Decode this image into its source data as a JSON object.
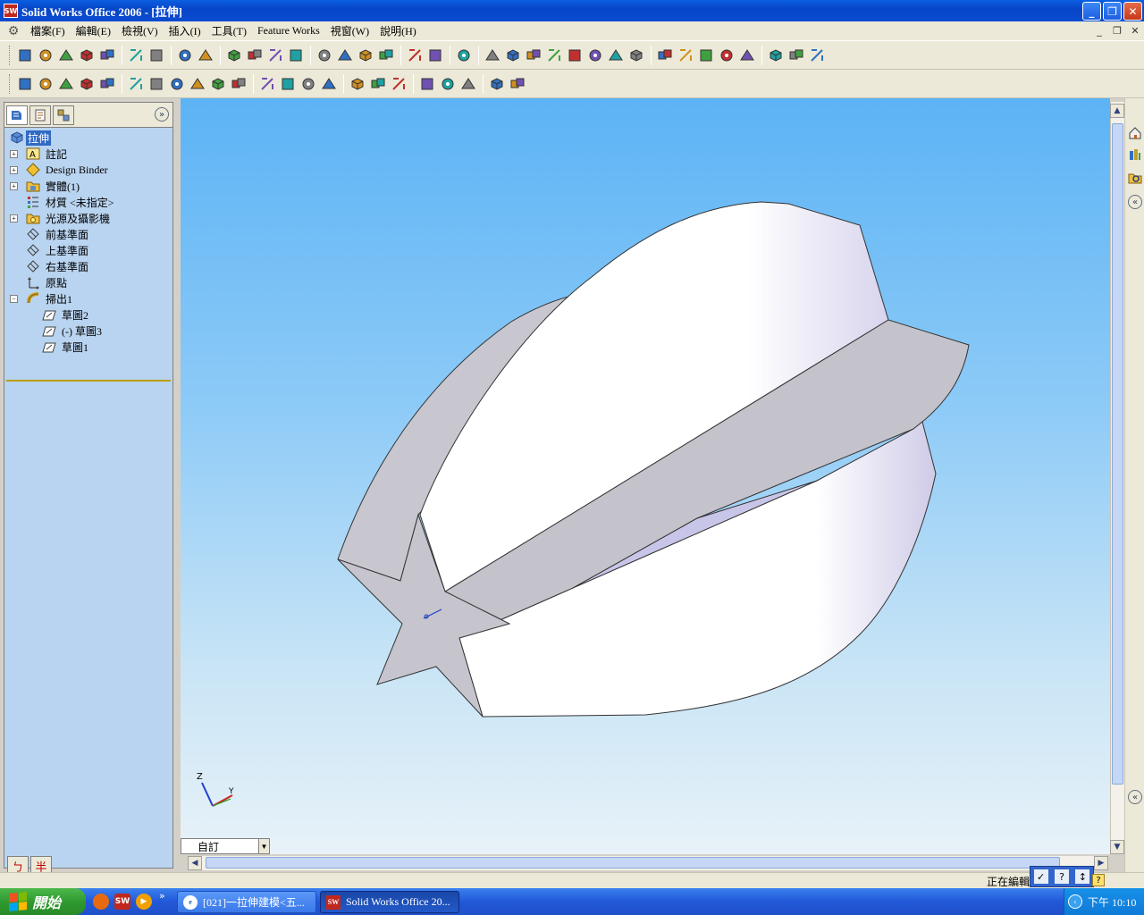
{
  "window": {
    "title": "Solid Works Office 2006 - [拉伸]",
    "app_icon_text": "SW",
    "minimize": "_",
    "maximize": "❐",
    "close": "✕"
  },
  "menu": {
    "items": [
      "檔案(F)",
      "編輯(E)",
      "檢視(V)",
      "插入(I)",
      "工具(T)",
      "Feature Works",
      "視窗(W)",
      "說明(H)"
    ],
    "mdi_minimize": "_",
    "mdi_restore": "❐",
    "mdi_close": "✕"
  },
  "toolbar1": {
    "icons": [
      "new-icon",
      "open-icon",
      "save-icon",
      "print-setup-icon",
      "options-icon",
      "print-icon",
      "print-preview-icon",
      "undo-icon",
      "redo-icon",
      "select-icon",
      "select-filter-icon",
      "sketch-icon",
      "rebuild-icon",
      "grid-icon",
      "color-icon",
      "snap-icon",
      "smart-dim-icon",
      "properties-icon",
      "help-icon",
      "measure-icon",
      "zoom-fit-icon",
      "zoom-area-icon",
      "zoom-in-out-icon",
      "zoom-selection-icon",
      "rotate-icon",
      "pan-icon",
      "view-orient-icon",
      "standard-views-icon",
      "wireframe-icon",
      "hidden-lines-visible-icon",
      "hidden-lines-removed-icon",
      "shaded-edges-icon",
      "shaded-icon",
      "shadows-icon",
      "section-view-icon",
      "realview-icon"
    ]
  },
  "toolbar2": {
    "icons": [
      "extrude-boss-icon",
      "revolve-icon",
      "sweep-icon",
      "loft-icon",
      "fillet-icon",
      "chamfer-icon",
      "rib-icon",
      "shell-icon",
      "draft-icon",
      "hole-wizard-icon",
      "dome-icon",
      "shape-icon",
      "flex-icon",
      "deform-icon",
      "indent-icon",
      "linear-pattern-icon",
      "circular-pattern-icon",
      "mirror-icon",
      "curve-driven-icon",
      "split-line-icon",
      "helix-icon",
      "instant3d-icon",
      "features-icon"
    ]
  },
  "feature_tree": {
    "root": "拉伸",
    "items": [
      {
        "label": "註記",
        "icon": "annotations-icon",
        "expand": "+"
      },
      {
        "label": "Design Binder",
        "icon": "design-binder-icon",
        "expand": "+"
      },
      {
        "label": "實體(1)",
        "icon": "solid-bodies-icon",
        "expand": "+"
      },
      {
        "label": "材質 <未指定>",
        "icon": "material-icon",
        "expand": ""
      },
      {
        "label": "光源及攝影機",
        "icon": "lights-cameras-icon",
        "expand": "+"
      },
      {
        "label": "前基準面",
        "icon": "plane-icon",
        "expand": ""
      },
      {
        "label": "上基準面",
        "icon": "plane-icon",
        "expand": ""
      },
      {
        "label": "右基準面",
        "icon": "plane-icon",
        "expand": ""
      },
      {
        "label": "原點",
        "icon": "origin-icon",
        "expand": ""
      },
      {
        "label": "掃出1",
        "icon": "sweep-feature-icon",
        "expand": "−"
      },
      {
        "label": "草圖2",
        "icon": "sketch-icon",
        "expand": ""
      },
      {
        "label": "(-) 草圖3",
        "icon": "sketch-icon",
        "expand": ""
      },
      {
        "label": "草圖1",
        "icon": "sketch-icon",
        "expand": ""
      }
    ],
    "expand_panel_glyph": "»"
  },
  "ime_bar": {
    "left": "ㄅ",
    "right": "半"
  },
  "configuration": {
    "value": "自訂",
    "arrow": "▼"
  },
  "scrollbar": {
    "up": "▲",
    "down": "▼",
    "left": "◀",
    "right": "▶"
  },
  "task_pane": {
    "icons": [
      "home-icon",
      "design-library-icon",
      "file-explorer-icon",
      "collapse-icon"
    ],
    "collapse_glyph": "«",
    "expand_glyph": "«"
  },
  "triad": {
    "z": "Z",
    "y": "Y"
  },
  "status_bar": {
    "text": "正在編輯",
    "ime_icons": [
      "✓",
      "?",
      "↕"
    ],
    "help": "?"
  },
  "taskbar": {
    "start_label": "開始",
    "quicklaunch": [
      {
        "icon": "firefox-icon",
        "color": "#e86a10"
      },
      {
        "icon": "solidworks-icon",
        "color": "#c0281e"
      },
      {
        "icon": "media-player-icon",
        "color": "#f0a000"
      }
    ],
    "quicklaunch_more": "»",
    "tasks": [
      {
        "label": "[021]一拉伸建模<五...",
        "active": false,
        "icon": "ie-icon"
      },
      {
        "label": "Solid Works Office 20...",
        "active": true,
        "icon": "solidworks-icon"
      }
    ],
    "tray_chevron": "‹",
    "clock": "下午 10:10"
  }
}
